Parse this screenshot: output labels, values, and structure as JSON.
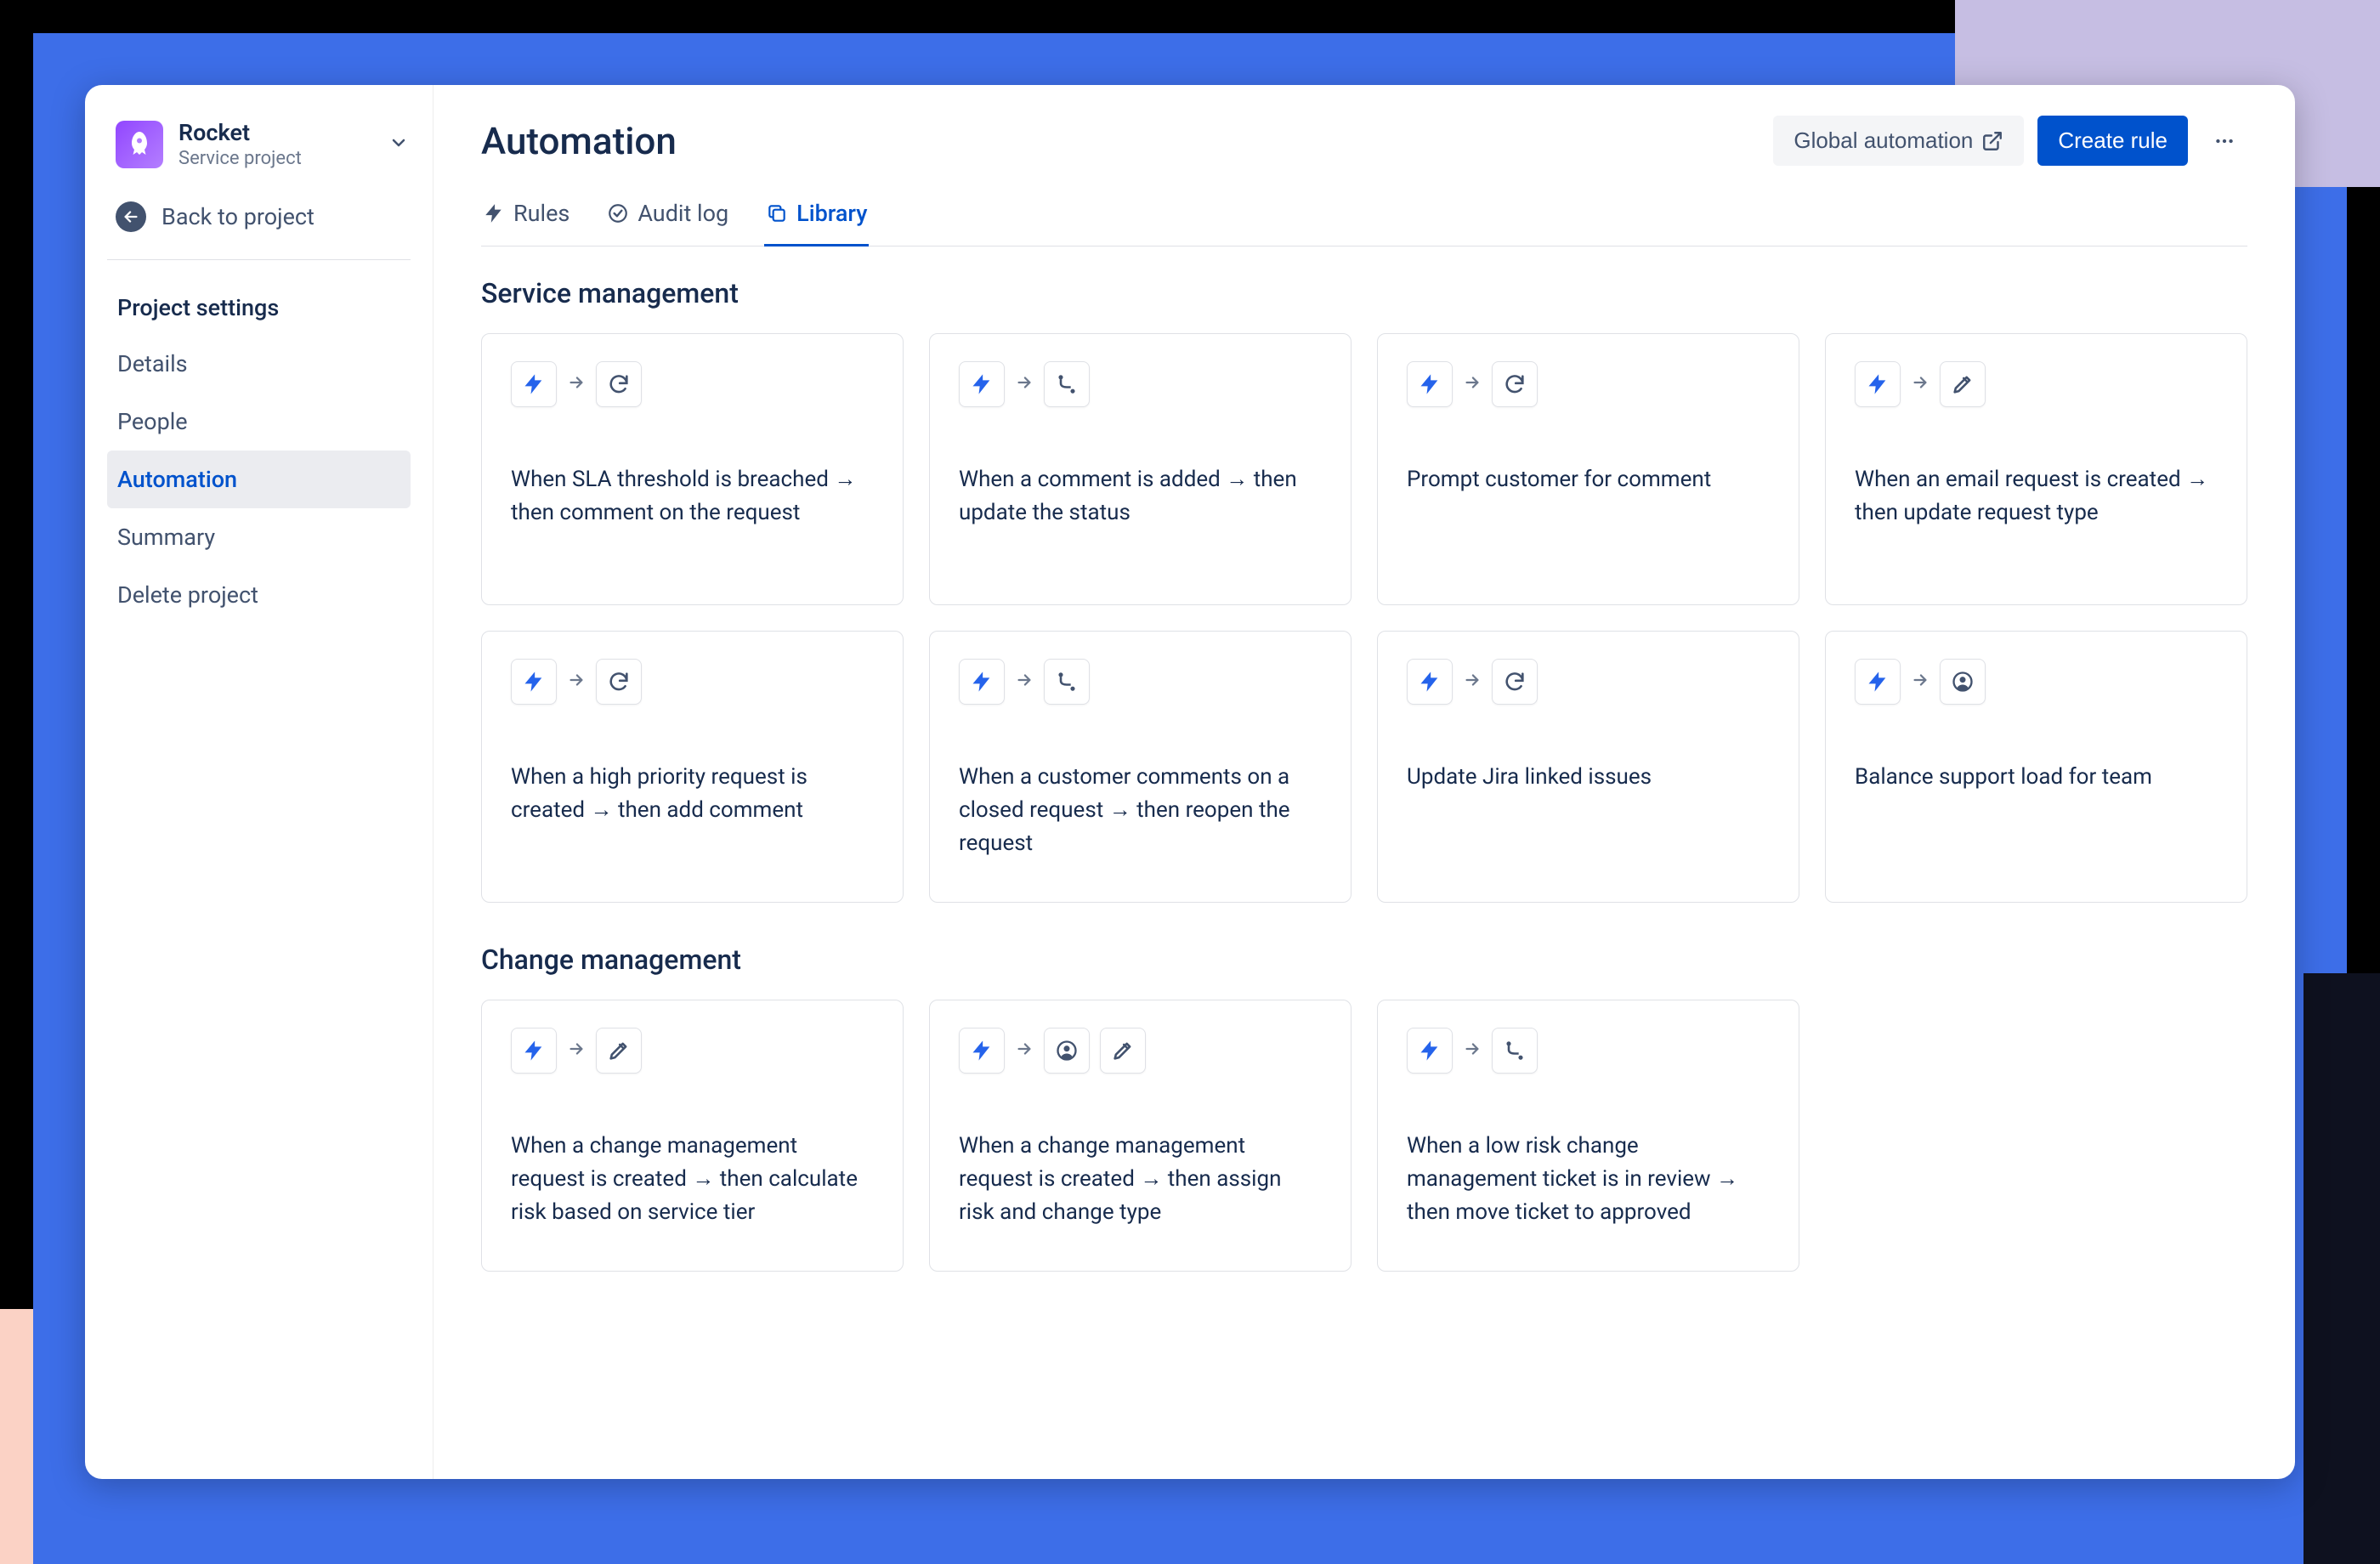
{
  "sidebar": {
    "project": {
      "name": "Rocket",
      "sub": "Service project"
    },
    "back": "Back to project",
    "heading": "Project settings",
    "items": [
      {
        "label": "Details",
        "active": false
      },
      {
        "label": "People",
        "active": false
      },
      {
        "label": "Automation",
        "active": true
      },
      {
        "label": "Summary",
        "active": false
      },
      {
        "label": "Delete project",
        "active": false
      }
    ]
  },
  "header": {
    "title": "Automation",
    "global_btn": "Global automation",
    "create_btn": "Create rule"
  },
  "tabs": [
    {
      "label": "Rules",
      "icon": "bolt",
      "active": false
    },
    {
      "label": "Audit log",
      "icon": "check-circle",
      "active": false
    },
    {
      "label": "Library",
      "icon": "copy",
      "active": true
    }
  ],
  "sections": [
    {
      "title": "Service management",
      "cards": [
        {
          "actions": [
            "refresh"
          ],
          "desc": "When SLA threshold is breached → then comment on the request"
        },
        {
          "actions": [
            "branch"
          ],
          "desc": "When a comment is added → then update the status"
        },
        {
          "actions": [
            "refresh"
          ],
          "desc": "Prompt customer for comment"
        },
        {
          "actions": [
            "pencil"
          ],
          "desc": "When an email request is created → then update request type"
        },
        {
          "actions": [
            "refresh"
          ],
          "desc": "When a high priority request is created → then add comment"
        },
        {
          "actions": [
            "branch"
          ],
          "desc": "When a customer comments on a closed request → then reopen the request"
        },
        {
          "actions": [
            "refresh"
          ],
          "desc": "Update Jira linked issues"
        },
        {
          "actions": [
            "person"
          ],
          "desc": "Balance support load for team"
        }
      ]
    },
    {
      "title": "Change management",
      "cards": [
        {
          "actions": [
            "pencil"
          ],
          "desc": "When a change management request is created → then calculate risk based on service tier"
        },
        {
          "actions": [
            "person",
            "pencil"
          ],
          "desc": "When a change management request is created → then assign risk and change type"
        },
        {
          "actions": [
            "branch"
          ],
          "desc": "When a low risk change management ticket is in review → then move ticket to approved"
        }
      ]
    }
  ]
}
